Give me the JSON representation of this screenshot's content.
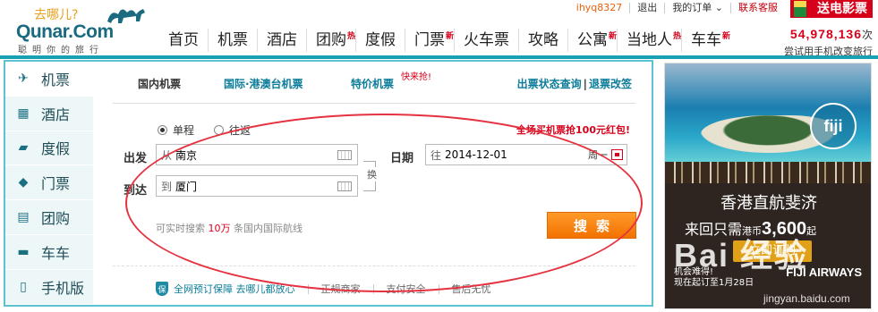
{
  "header": {
    "logo_cn": "去哪儿?",
    "logo_en": "Qunar.Com",
    "logo_slogan": "聪明你的旅行",
    "userbar": {
      "username": "ihyq8327",
      "logout": "退出",
      "orders": "我的订单",
      "service": "联系客服"
    },
    "promo": "送电影票",
    "nav": [
      {
        "label": "首页",
        "badge": ""
      },
      {
        "label": "机票",
        "badge": ""
      },
      {
        "label": "酒店",
        "badge": ""
      },
      {
        "label": "团购",
        "badge": "热"
      },
      {
        "label": "度假",
        "badge": ""
      },
      {
        "label": "门票",
        "badge": "新"
      },
      {
        "label": "火车票",
        "badge": ""
      },
      {
        "label": "攻略",
        "badge": ""
      },
      {
        "label": "公寓",
        "badge": "新"
      },
      {
        "label": "当地人",
        "badge": "热"
      },
      {
        "label": "车车",
        "badge": "新"
      }
    ],
    "counter": {
      "number": "54,978,136",
      "unit": "次",
      "subtitle": "尝试用手机改变旅行"
    }
  },
  "sidenav": [
    {
      "label": "机票",
      "icon": "plane-icon"
    },
    {
      "label": "酒店",
      "icon": "building-icon"
    },
    {
      "label": "度假",
      "icon": "suitcase-icon"
    },
    {
      "label": "门票",
      "icon": "tag-icon"
    },
    {
      "label": "团购",
      "icon": "basket-icon"
    },
    {
      "label": "车车",
      "icon": "car-icon"
    },
    {
      "label": "手机版",
      "icon": "phone-icon"
    }
  ],
  "search": {
    "tabs": {
      "domestic": "国内机票",
      "intl": "国际·港澳台机票",
      "special": "特价机票",
      "special_flash": "快来抢!",
      "status": "出票状态查询",
      "sep": "|",
      "refund": "退票改签"
    },
    "trip_type": {
      "oneway": "单程",
      "roundtrip": "往返"
    },
    "promo": "全场买机票抢100元红包!",
    "from_label": "出发",
    "from_prefix": "从",
    "from_value": "南京",
    "to_label": "到达",
    "to_prefix": "到",
    "to_value": "厦门",
    "swap": "换",
    "date_label": "日期",
    "date_prefix": "往",
    "date_value": "2014-12-01",
    "weekday": "周一",
    "hint_pre": "可实时搜索",
    "hint_num": "10万",
    "hint_post": "条国内国际航线",
    "button": "搜索"
  },
  "footer": {
    "guarantee": "全网预订保障 去哪儿都放心",
    "items": [
      "正规商家",
      "支付安全",
      "售后无忧"
    ]
  },
  "ad": {
    "brand": "fiji",
    "title": "香港直航斐济",
    "price_pre": "来回只需",
    "currency": "港币",
    "price": "3,600",
    "price_post": "起",
    "cta": "立即订购",
    "note1": "机会难得!",
    "note2": "现在起订至1月28日",
    "airline": "FIJI AIRWAYS",
    "watermark": "Bai 经验",
    "watermark_sub": "jingyan.baidu.com"
  },
  "colors": {
    "accent": "#19a0b4",
    "highlight": "#e53240",
    "button": "#f27200",
    "link": "#0b7c99"
  }
}
